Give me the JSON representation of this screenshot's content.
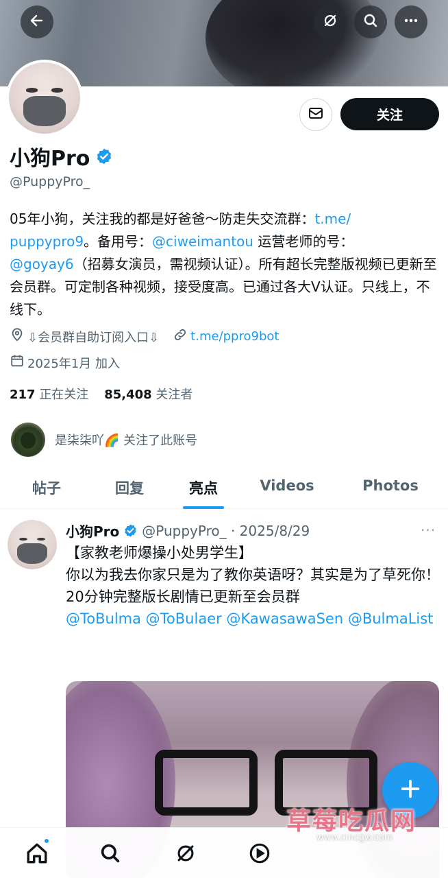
{
  "header": {
    "back_icon": "arrow-left-icon",
    "grok_icon": "grok-icon",
    "search_icon": "search-icon",
    "more_icon": "more-icon"
  },
  "profile": {
    "name": "小狗Pro",
    "handle": "@PuppyPro_",
    "follow_label": "关注",
    "bio": {
      "p1": "05年小狗，关注我的都是好爸爸～防走失交流群：",
      "link1": "t.me/\npuppypro9",
      "p2": "。备用号：",
      "link2": "@ciweimantou",
      "p3": " 运营老师的号：",
      "link3": "@goyay6",
      "p4": "（招募女演员，需视频认证）。所有超长完整版视频已更新至会员群。可定制各种视频，接受度高。已通过各大V认证。只线上，不线下。"
    },
    "location": "⇩会员群自助订阅入口⇩",
    "website": "t.me/ppro9bot",
    "joined": "2025年1月 加入",
    "following_count": "217",
    "following_label": "正在关注",
    "followers_count": "85,408",
    "followers_label": "关注者",
    "followed_by": "是柒柒吖🌈 关注了此账号"
  },
  "tabs": [
    {
      "label": "帖子",
      "active": false
    },
    {
      "label": "回复",
      "active": false
    },
    {
      "label": "亮点",
      "active": true
    },
    {
      "label": "Videos",
      "active": false
    },
    {
      "label": "Photos",
      "active": false
    }
  ],
  "post": {
    "name": "小狗Pro",
    "meta": "@PuppyPro_ · 2025/8/29",
    "more": "···",
    "line1": "【家教老师爆操小处男学生】",
    "line2": "你以为我去你家只是为了教你英语呀？其实是为了草死你！",
    "line3": "20分钟完整版长剧情已更新至会员群",
    "mentions": "@ToBulma @ToBulaer @KawasawaSen @BulmaList"
  },
  "watermark": {
    "text": "草莓吃瓜网",
    "sub": "www.cmcgw.com"
  },
  "colors": {
    "accent": "#1d9bf0",
    "text": "#0f1419",
    "muted": "#536471"
  }
}
